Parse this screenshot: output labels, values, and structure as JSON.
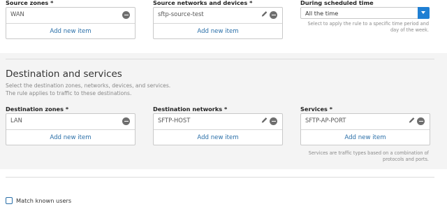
{
  "source": {
    "zones": {
      "label": "Source zones *",
      "item": "WAN",
      "add": "Add new item"
    },
    "networks": {
      "label": "Source networks and devices *",
      "item": "sftp-source-test",
      "add": "Add new item"
    }
  },
  "schedule": {
    "label": "During scheduled time",
    "value": "All the time",
    "help_line1": "Select to apply the rule to a specific time period and",
    "help_line2": "day of the week."
  },
  "destination": {
    "title": "Destination and services",
    "desc_line1": "Select the destination zones, networks, devices, and services.",
    "desc_line2": "The rule applies to traffic to these destinations.",
    "zones": {
      "label": "Destination zones *",
      "item": "LAN",
      "add": "Add new item"
    },
    "networks": {
      "label": "Destination networks *",
      "item": "SFTP-HOST",
      "add": "Add new item"
    },
    "services": {
      "label": "Services *",
      "item": "SFTP-AP-PORT",
      "add": "Add new item",
      "help_line1": "Services are traffic types based on a combination of",
      "help_line2": "protocols and ports."
    }
  },
  "match_users": {
    "label": "Match known users",
    "checked": false
  },
  "colors": {
    "accent": "#1f7fd3",
    "link": "#2a6fa8",
    "band": "#f4f4f4"
  },
  "icons": {
    "remove": "minus-circle-icon",
    "edit": "pencil-icon",
    "dropdown": "chevron-down-icon"
  }
}
